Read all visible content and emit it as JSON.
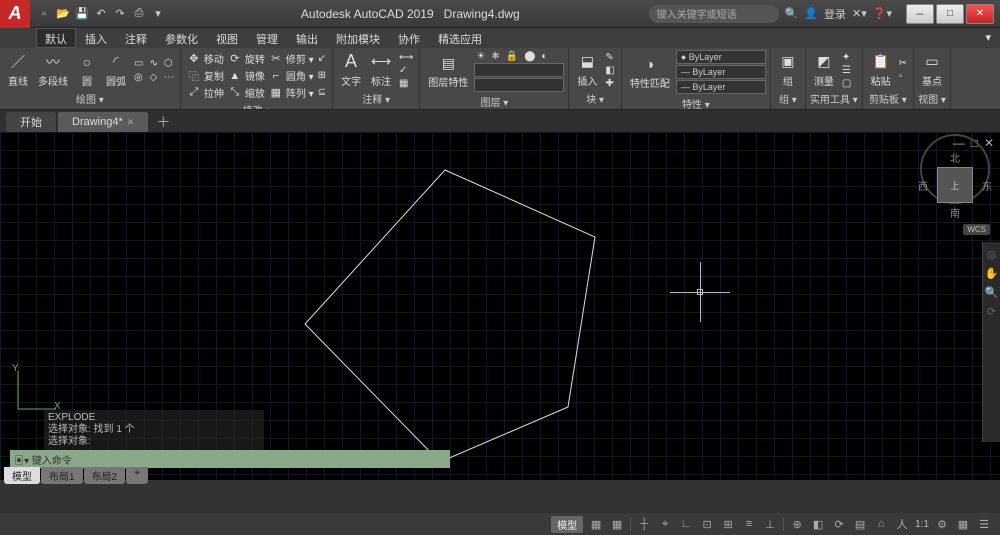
{
  "app": {
    "title_prefix": "Autodesk AutoCAD 2019",
    "filename": "Drawing4.dwg",
    "logo_letter": "A"
  },
  "qat_icons": [
    "new",
    "open",
    "save",
    "undo",
    "redo",
    "plot",
    "share"
  ],
  "search": {
    "placeholder": "键入关键字或短语",
    "icon": "🔍"
  },
  "user": {
    "login_label": "登录",
    "icon": "👤"
  },
  "menubar": [
    "默认",
    "插入",
    "注释",
    "参数化",
    "视图",
    "管理",
    "输出",
    "附加模块",
    "协作",
    "精选应用"
  ],
  "ribbon": {
    "draw": {
      "title": "绘图 ▾",
      "big": [
        {
          "name": "line",
          "icon": "／",
          "label": "直线"
        },
        {
          "name": "polyline",
          "icon": "〰",
          "label": "多段线"
        },
        {
          "name": "circle",
          "icon": "○",
          "label": "圆"
        },
        {
          "name": "arc",
          "icon": "◜",
          "label": "圆弧"
        }
      ],
      "grid": [
        {
          "icon": "▭"
        },
        {
          "icon": "∿"
        },
        {
          "icon": "⬡"
        },
        {
          "icon": "◎"
        },
        {
          "icon": "◇"
        },
        {
          "icon": "⋯"
        }
      ]
    },
    "modify": {
      "title": "修改 ▾",
      "rows": [
        [
          {
            "icon": "✥",
            "label": "移动"
          },
          {
            "icon": "⟳",
            "label": "旋转"
          },
          {
            "icon": "✂",
            "label": "修剪 ▾"
          },
          {
            "icon": "↙"
          }
        ],
        [
          {
            "icon": "⿻",
            "label": "复制"
          },
          {
            "icon": "▲",
            "label": "镜像"
          },
          {
            "icon": "⌐",
            "label": "圆角 ▾"
          },
          {
            "icon": "⊞"
          }
        ],
        [
          {
            "icon": "⤢",
            "label": "拉伸"
          },
          {
            "icon": "⤡",
            "label": "缩放"
          },
          {
            "icon": "▦",
            "label": "阵列 ▾"
          },
          {
            "icon": "⊆"
          }
        ]
      ]
    },
    "anno": {
      "title": "注释 ▾",
      "text": {
        "icon": "A",
        "label": "文字"
      },
      "dim": {
        "icon": "⟷",
        "label": "标注"
      },
      "grid": [
        {
          "icon": "⟷"
        },
        {
          "icon": "✓"
        },
        {
          "icon": "▦"
        }
      ]
    },
    "layers": {
      "title": "图层 ▾",
      "big": {
        "icon": "▤",
        "label": "图层特性"
      },
      "icons": [
        "☀",
        "❄",
        "🔒",
        "⬤",
        "◐"
      ],
      "dd1": "",
      "dd2": ""
    },
    "block": {
      "title": "块 ▾",
      "big": {
        "icon": "⬓",
        "label": "插入"
      },
      "grid": [
        {
          "icon": "✎"
        },
        {
          "icon": "◧"
        },
        {
          "icon": "✚"
        }
      ]
    },
    "props": {
      "title": "特性 ▾",
      "big": {
        "icon": "◑",
        "label": "特性匹配"
      },
      "dd": [
        "● ByLayer",
        "— ByLayer",
        "— ByLayer"
      ]
    },
    "group": {
      "title": "组 ▾",
      "big": {
        "icon": "▣",
        "label": "组"
      }
    },
    "utils": {
      "title": "实用工具 ▾",
      "big": {
        "icon": "◩",
        "label": "测量"
      },
      "grid": [
        {
          "icon": "✦"
        },
        {
          "icon": "☰"
        },
        {
          "icon": "▢"
        }
      ]
    },
    "clip": {
      "title": "剪贴板 ▾",
      "big": {
        "icon": "📋",
        "label": "粘贴"
      },
      "grid": [
        {
          "icon": "✂"
        },
        {
          "icon": "▫"
        }
      ]
    },
    "view": {
      "title": "视图 ▾",
      "big": {
        "icon": "▭",
        "label": "基点"
      }
    }
  },
  "doctabs": {
    "start": "开始",
    "active": "Drawing4*"
  },
  "viewcube": {
    "n": "北",
    "s": "南",
    "e": "东",
    "w": "西",
    "face": "上",
    "wcs": "WCS"
  },
  "ucs": {
    "y": "Y",
    "x": "X"
  },
  "command": {
    "history": [
      "EXPLODE",
      "选择对象: 找到 1 个",
      "选择对象:"
    ],
    "prompt": "▣▾ 键入命令"
  },
  "modeltabs": {
    "model": "模型",
    "l1": "布局1",
    "l2": "布局2",
    "add": "+"
  },
  "statusbar": {
    "model": "模型",
    "scale": "1:1",
    "icons": [
      "▦",
      "▦",
      "┼",
      "⌖",
      "∟",
      "⊡",
      "⊞",
      "≡",
      "⊥",
      "⊕",
      "◧",
      "⟳",
      "▤",
      "⌂",
      "人",
      "⚙",
      "▦",
      "☰"
    ]
  }
}
